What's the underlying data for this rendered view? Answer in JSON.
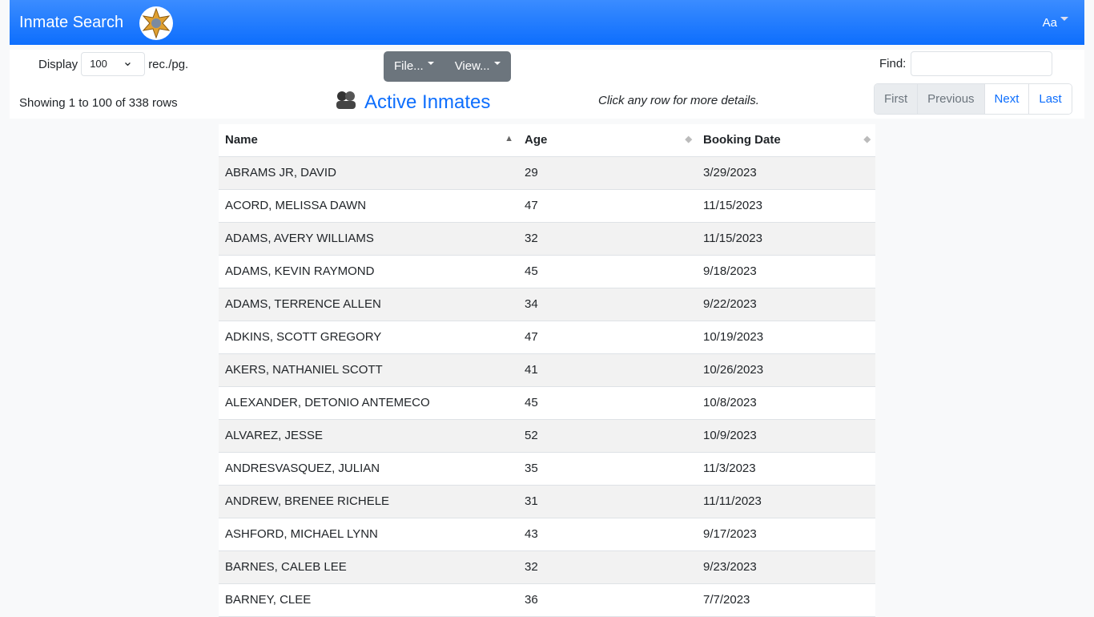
{
  "nav": {
    "brand": "Inmate Search",
    "font_menu": "Aa"
  },
  "toolbar": {
    "display_label": "Display",
    "per_page": "100",
    "per_page_suffix": "rec./pg.",
    "file_menu": "File...",
    "view_menu": "View...",
    "find_label": "Find:",
    "find_value": "",
    "showing": "Showing 1 to 100 of 338 rows",
    "title": "Active Inmates",
    "hint": "Click any row for more details.",
    "pager": {
      "first": "First",
      "previous": "Previous",
      "next": "Next",
      "last": "Last"
    }
  },
  "table": {
    "headers": [
      "Name",
      "Age",
      "Booking Date"
    ],
    "rows": [
      [
        "ABRAMS JR, DAVID",
        "29",
        "3/29/2023"
      ],
      [
        "ACORD, MELISSA DAWN",
        "47",
        "11/15/2023"
      ],
      [
        "ADAMS, AVERY WILLIAMS",
        "32",
        "11/15/2023"
      ],
      [
        "ADAMS, KEVIN RAYMOND",
        "45",
        "9/18/2023"
      ],
      [
        "ADAMS, TERRENCE ALLEN",
        "34",
        "9/22/2023"
      ],
      [
        "ADKINS, SCOTT GREGORY",
        "47",
        "10/19/2023"
      ],
      [
        "AKERS, NATHANIEL SCOTT",
        "41",
        "10/26/2023"
      ],
      [
        "ALEXANDER, DETONIO ANTEMECO",
        "45",
        "10/8/2023"
      ],
      [
        "ALVAREZ, JESSE",
        "52",
        "10/9/2023"
      ],
      [
        "ANDRESVASQUEZ, JULIAN",
        "35",
        "11/3/2023"
      ],
      [
        "ANDREW, BRENEE RICHELE",
        "31",
        "11/11/2023"
      ],
      [
        "ASHFORD, MICHAEL LYNN",
        "43",
        "9/17/2023"
      ],
      [
        "BARNES, CALEB LEE",
        "32",
        "9/23/2023"
      ],
      [
        "BARNEY, CLEE",
        "36",
        "7/7/2023"
      ]
    ]
  }
}
